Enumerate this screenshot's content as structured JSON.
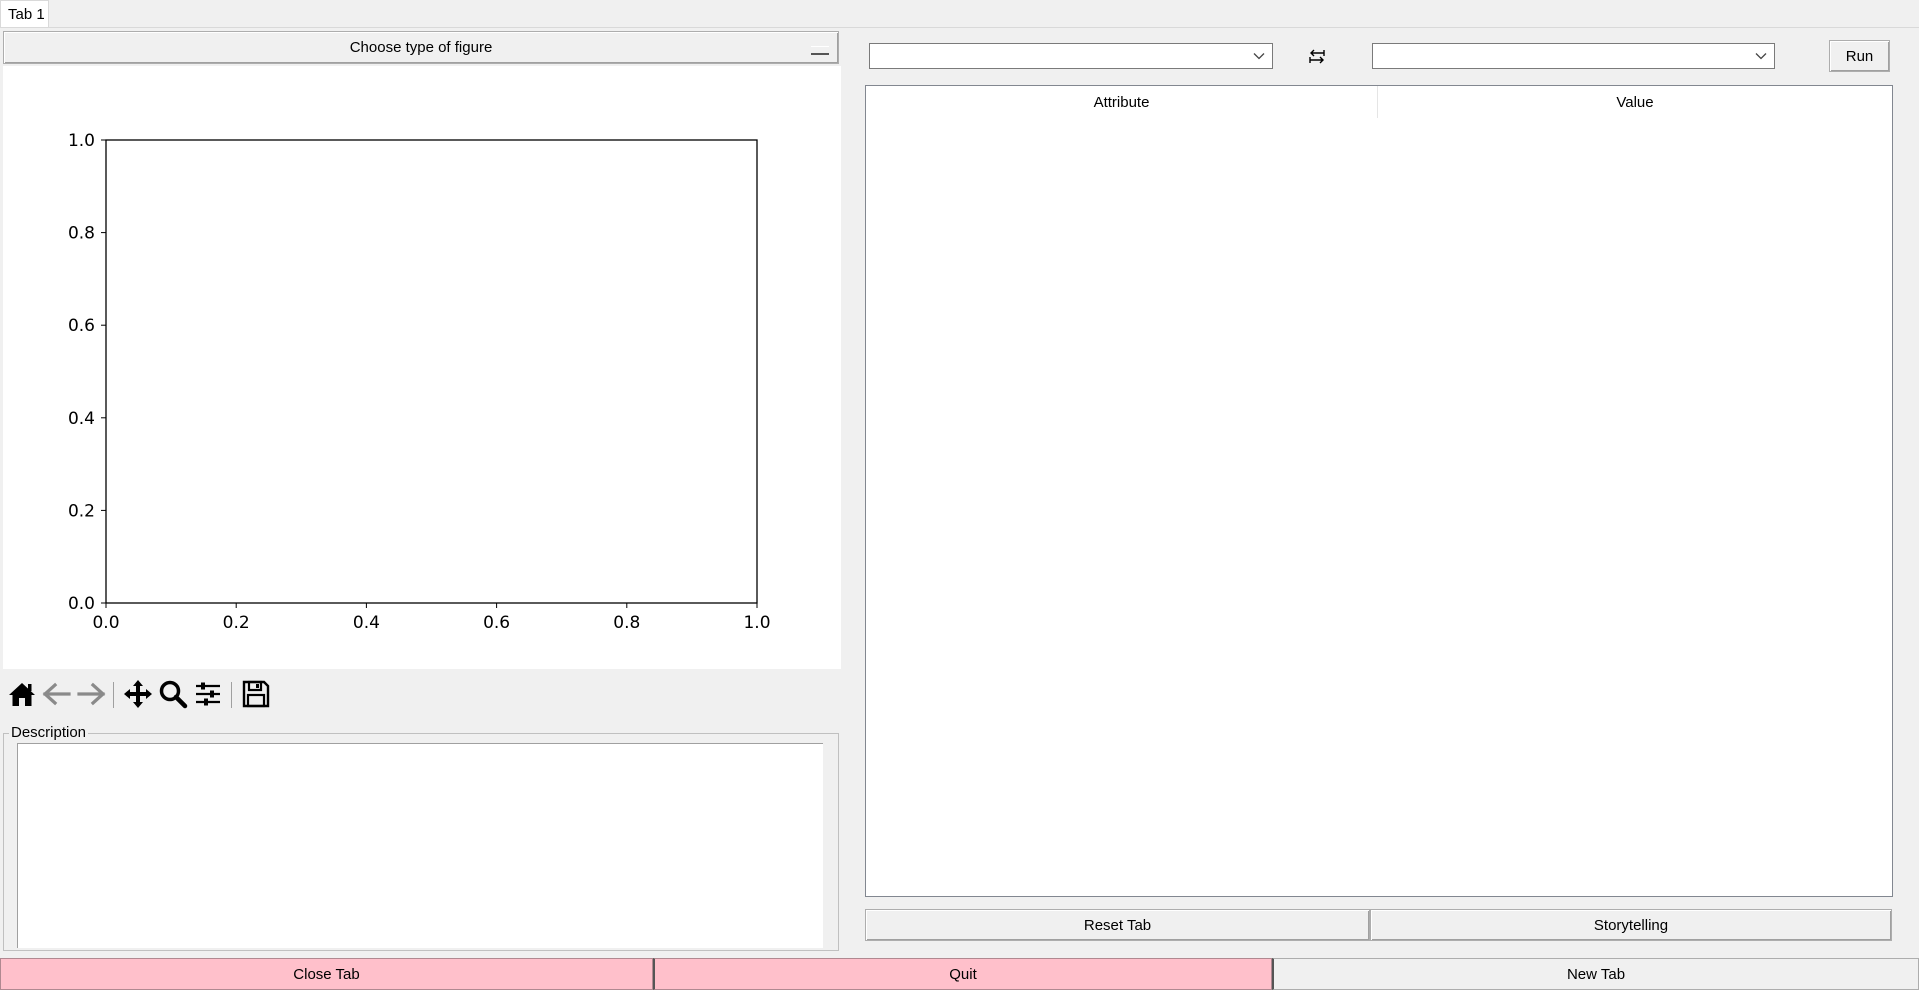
{
  "tabs": [
    "Tab 1"
  ],
  "figure_type_button": {
    "label": "Choose type of figure"
  },
  "chart_data": {
    "type": "scatter",
    "title": "",
    "xlabel": "",
    "ylabel": "",
    "xlim": [
      0.0,
      1.0
    ],
    "ylim": [
      0.0,
      1.0
    ],
    "xticks": [
      "0.0",
      "0.2",
      "0.4",
      "0.6",
      "0.8",
      "1.0"
    ],
    "yticks": [
      "0.0",
      "0.2",
      "0.4",
      "0.6",
      "0.8",
      "1.0"
    ],
    "series": [],
    "grid": false
  },
  "plot_toolbar": {
    "icons": [
      "home-icon",
      "back-arrow-icon",
      "forward-arrow-icon",
      "pan-icon",
      "zoom-icon",
      "configure-subplots-icon",
      "save-icon"
    ]
  },
  "description": {
    "label": "Description",
    "text": ""
  },
  "right_panel": {
    "combo_left": {
      "value": ""
    },
    "swap_icon": "swap-icon",
    "combo_right": {
      "value": ""
    },
    "run_label": "Run",
    "table": {
      "columns": [
        "Attribute",
        "Value"
      ],
      "rows": []
    },
    "reset_label": "Reset Tab",
    "storytelling_label": "Storytelling"
  },
  "bottom_bar": {
    "close_tab_label": "Close Tab",
    "quit_label": "Quit",
    "new_tab_label": "New Tab",
    "danger_color": "#ffc0cb"
  }
}
